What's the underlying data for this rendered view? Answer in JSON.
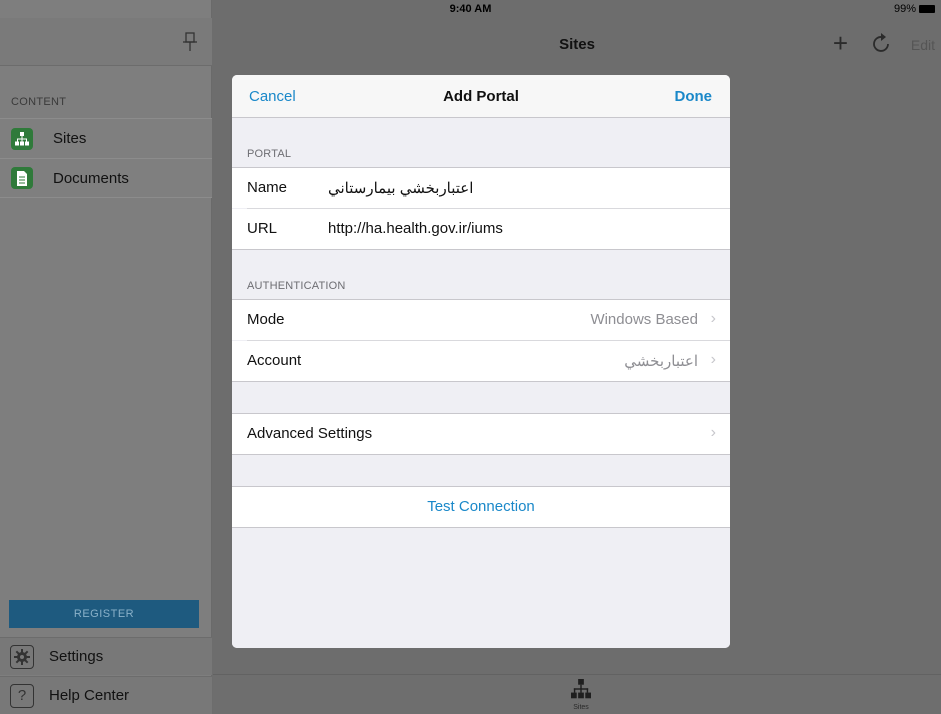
{
  "status": {
    "device": "iPad",
    "time": "9:40 AM",
    "battery": "99%"
  },
  "sidebar": {
    "section": "CONTENT",
    "items": [
      {
        "label": "Sites",
        "icon": "sitemap-icon"
      },
      {
        "label": "Documents",
        "icon": "document-icon"
      }
    ],
    "register": "REGISTER",
    "bottom": [
      {
        "label": "Settings",
        "icon": "gear-icon"
      },
      {
        "label": "Help Center",
        "icon": "question-icon"
      }
    ]
  },
  "nav": {
    "title": "Sites",
    "add": "+",
    "edit": "Edit"
  },
  "tabbar": {
    "tab_label": "Sites"
  },
  "modal": {
    "cancel": "Cancel",
    "title": "Add Portal",
    "done": "Done",
    "portal_section": "PORTAL",
    "name_label": "Name",
    "name_value": "اعتباربخشي بيمارستاني",
    "url_label": "URL",
    "url_value": "http://ha.health.gov.ir/iums",
    "auth_section": "AUTHENTICATION",
    "mode_label": "Mode",
    "mode_value": "Windows Based",
    "account_label": "Account",
    "account_value": "اعتباربخشي",
    "advanced": "Advanced Settings",
    "test": "Test Connection"
  },
  "colors": {
    "accent": "#1a88c9",
    "register_bg": "#1e5a7f",
    "icon_green": "#2f7a3a"
  }
}
